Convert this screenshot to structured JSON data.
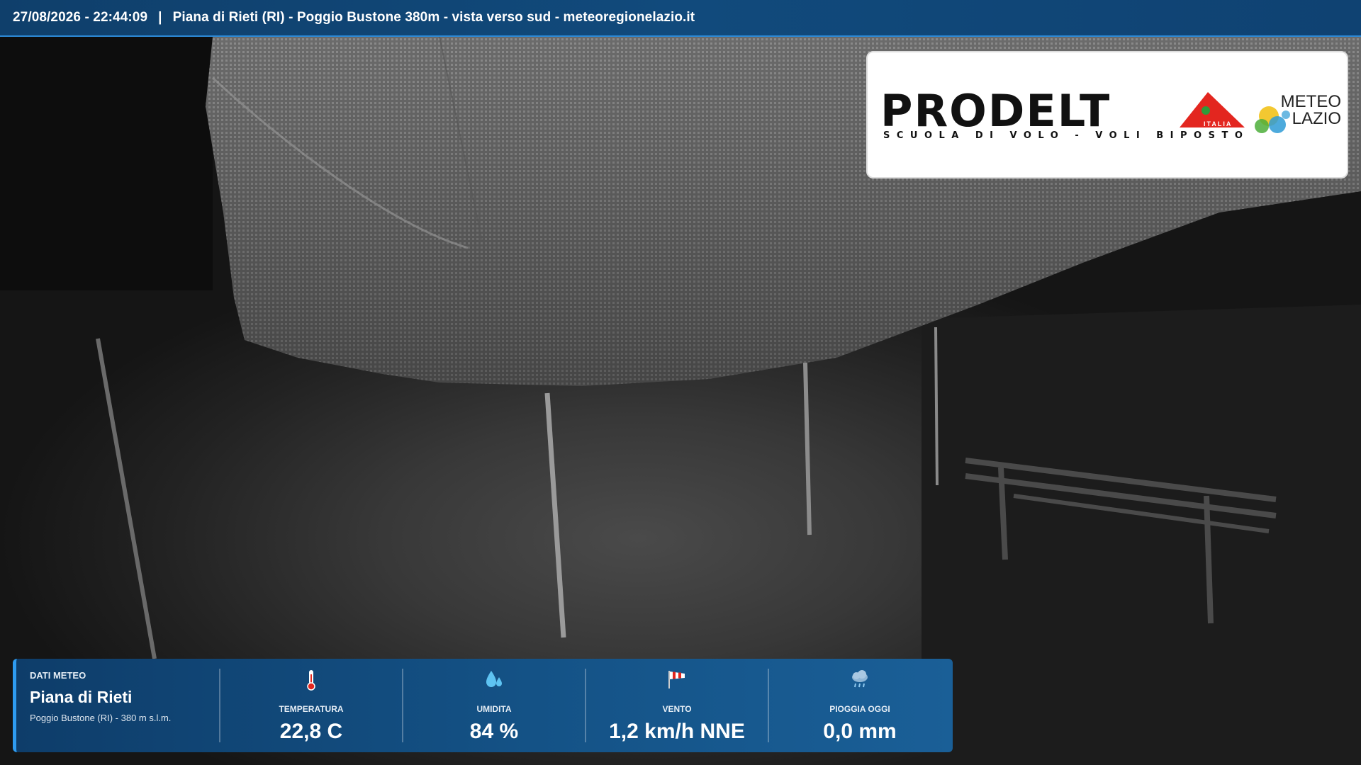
{
  "topbar": {
    "datetime": "27/08/2026 - 22:44:09",
    "separator": "|",
    "location_title": "Piana di Rieti (RI) - Poggio Bustone 380m - vista verso sud - meteoregionelazio.it"
  },
  "logo": {
    "main": "PRODELT",
    "italia": "ITALIA",
    "tagline": "SCUOLA DI VOLO - VOLI BIPOSTO",
    "partner_line1": "METEO",
    "partner_line2": "LAZIO"
  },
  "panel": {
    "section_label": "DATI METEO",
    "station_name": "Piana di Rieti",
    "station_sub": "Poggio Bustone (RI) - 380 m s.l.m.",
    "metrics": [
      {
        "label": "TEMPERATURA",
        "value": "22,8  C",
        "icon": "thermometer-icon"
      },
      {
        "label": "UMIDITA",
        "value": "84 %",
        "icon": "droplets-icon"
      },
      {
        "label": "VENTO",
        "value": "1,2 km/h NNE",
        "icon": "windsock-icon"
      },
      {
        "label": "PIOGGIA OGGI",
        "value": "0,0 mm",
        "icon": "rain-cloud-icon"
      }
    ]
  },
  "colors": {
    "bar_blue": "#114a7c",
    "accent_blue": "#2e9bf0",
    "logo_red": "#e3261f"
  }
}
